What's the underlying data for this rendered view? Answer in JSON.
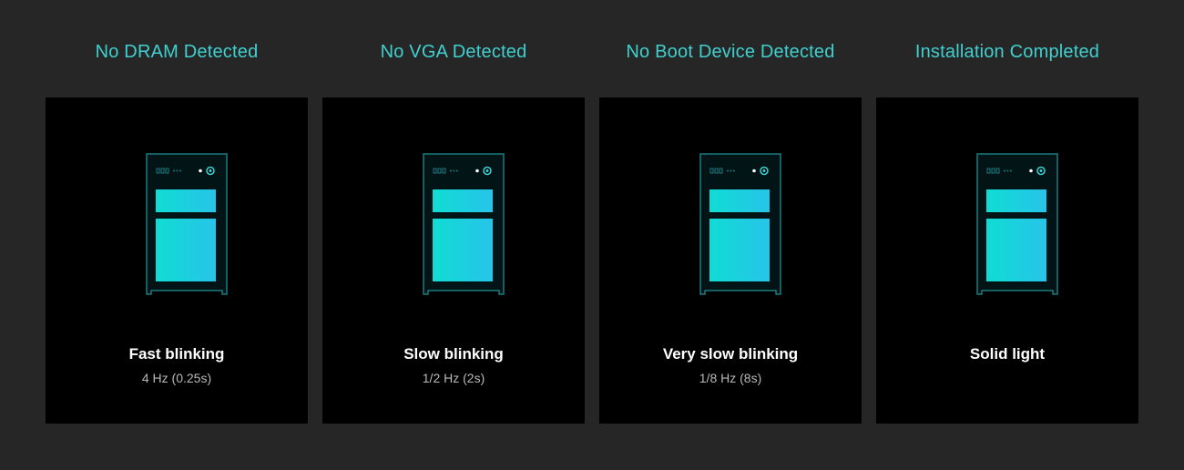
{
  "colors": {
    "background": "#262626",
    "panel": "#000000",
    "title": "#3fd0cf",
    "outline": "#1b7b80",
    "gradient_start": "#10dcd2",
    "gradient_end": "#27c4ea",
    "label": "#ffffff",
    "frequency": "#b8b8b8"
  },
  "states": [
    {
      "title": "No DRAM Detected",
      "icon": "pc-tower-icon",
      "pattern": "Fast blinking",
      "frequency": "4 Hz (0.25s)"
    },
    {
      "title": "No VGA Detected",
      "icon": "pc-tower-icon",
      "pattern": "Slow blinking",
      "frequency": "1/2 Hz (2s)"
    },
    {
      "title": "No Boot Device Detected",
      "icon": "pc-tower-icon",
      "pattern": "Very slow blinking",
      "frequency": "1/8 Hz (8s)"
    },
    {
      "title": "Installation Completed",
      "icon": "pc-tower-icon",
      "pattern": "Solid light",
      "frequency": ""
    }
  ]
}
